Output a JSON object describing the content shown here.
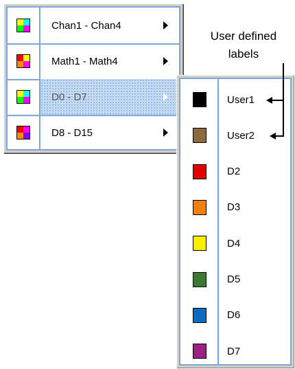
{
  "menu": {
    "items": [
      {
        "label": "Chan1 - Chan4",
        "icon": "channel-grid-icon",
        "colors": [
          "#ffff00",
          "#00ffff",
          "#00ff00",
          "#ff00ff"
        ],
        "has_submenu": true,
        "selected": false
      },
      {
        "label": "Math1 - Math4",
        "icon": "math-grid-icon",
        "colors": [
          "#ff0000",
          "#ffff00",
          "#ff8800",
          "#ff00ff"
        ],
        "has_submenu": true,
        "selected": false
      },
      {
        "label": "D0 - D7",
        "icon": "digital-grid-icon",
        "colors": [
          "#ffff00",
          "#00ffff",
          "#00ff00",
          "#ff00ff"
        ],
        "has_submenu": true,
        "selected": true
      },
      {
        "label": "D8 - D15",
        "icon": "digital-grid-icon",
        "colors": [
          "#ff0000",
          "#ff00ff",
          "#ff8800",
          "#8800ff"
        ],
        "has_submenu": true,
        "selected": false
      }
    ]
  },
  "submenu": {
    "items": [
      {
        "label": "User1",
        "color": "#000000"
      },
      {
        "label": "User2",
        "color": "#8c6a40"
      },
      {
        "label": "D2",
        "color": "#e00000"
      },
      {
        "label": "D3",
        "color": "#f08010"
      },
      {
        "label": "D4",
        "color": "#f8f000"
      },
      {
        "label": "D5",
        "color": "#3a7a30"
      },
      {
        "label": "D6",
        "color": "#0a6cc0"
      },
      {
        "label": "D7",
        "color": "#a02080"
      }
    ]
  },
  "annotation": {
    "line1": "User defined",
    "line2": "labels"
  }
}
